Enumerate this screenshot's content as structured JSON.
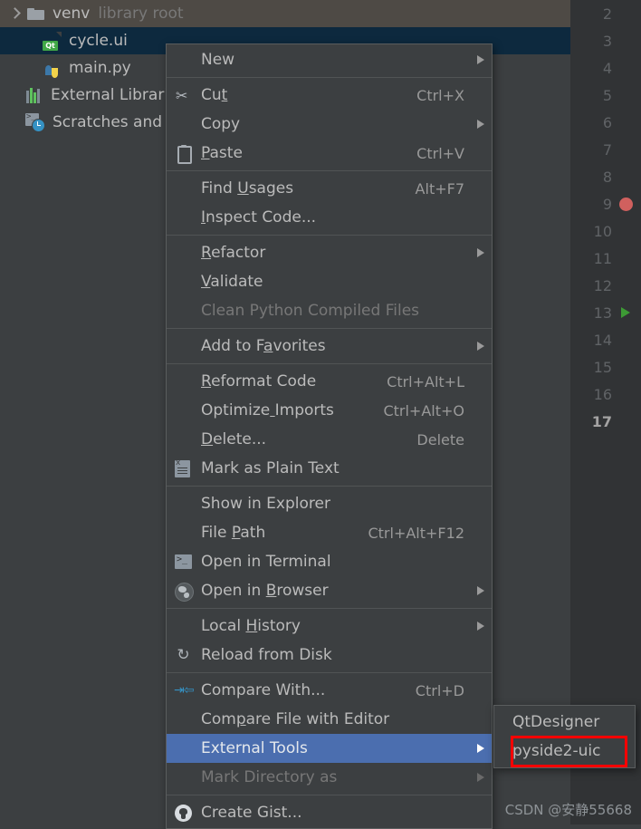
{
  "tree": {
    "rows": [
      {
        "label": "venv",
        "sub": "library root",
        "icon": "folder-icon",
        "state": "hovered",
        "indent": 0,
        "expander": "chevron-right-icon"
      },
      {
        "label": "cycle.ui",
        "sub": "",
        "icon": "qt-ui-file-icon",
        "state": "selected",
        "indent": 1,
        "expander": ""
      },
      {
        "label": "main.py",
        "sub": "",
        "icon": "python-file-icon",
        "state": "normal",
        "indent": 1,
        "expander": ""
      },
      {
        "label": "External Libraries",
        "sub": "",
        "icon": "libraries-bars-icon",
        "state": "normal",
        "indent": 0,
        "expander": ""
      },
      {
        "label": "Scratches and Co",
        "sub": "",
        "icon": "scratches-clock-icon",
        "state": "normal",
        "indent": 0,
        "expander": ""
      }
    ]
  },
  "gutter": {
    "lines": [
      {
        "num": "2",
        "marker": "",
        "current": false
      },
      {
        "num": "3",
        "marker": "",
        "current": false
      },
      {
        "num": "4",
        "marker": "",
        "current": false
      },
      {
        "num": "5",
        "marker": "",
        "current": false
      },
      {
        "num": "6",
        "marker": "",
        "current": false
      },
      {
        "num": "7",
        "marker": "",
        "current": false
      },
      {
        "num": "8",
        "marker": "",
        "current": false
      },
      {
        "num": "9",
        "marker": "breakpoint",
        "current": false
      },
      {
        "num": "10",
        "marker": "",
        "current": false
      },
      {
        "num": "11",
        "marker": "",
        "current": false
      },
      {
        "num": "12",
        "marker": "",
        "current": false
      },
      {
        "num": "13",
        "marker": "run",
        "current": false
      },
      {
        "num": "14",
        "marker": "",
        "current": false
      },
      {
        "num": "15",
        "marker": "",
        "current": false
      },
      {
        "num": "16",
        "marker": "",
        "current": false
      },
      {
        "num": "17",
        "marker": "",
        "current": true
      }
    ]
  },
  "context_menu": {
    "items": [
      {
        "label": "New",
        "shortcut": "",
        "icon": "",
        "submenu": true,
        "disabled": false,
        "selected": false,
        "sep_after": true
      },
      {
        "label": "Cut",
        "shortcut": "Ctrl+X",
        "icon": "scissors-icon",
        "submenu": false,
        "disabled": false,
        "selected": false,
        "sep_after": false
      },
      {
        "label": "Copy",
        "shortcut": "",
        "icon": "",
        "submenu": true,
        "disabled": false,
        "selected": false,
        "sep_after": false
      },
      {
        "label": "Paste",
        "shortcut": "Ctrl+V",
        "icon": "clipboard-icon",
        "submenu": false,
        "disabled": false,
        "selected": false,
        "sep_after": true
      },
      {
        "label": "Find Usages",
        "shortcut": "Alt+F7",
        "icon": "",
        "submenu": false,
        "disabled": false,
        "selected": false,
        "sep_after": false
      },
      {
        "label": "Inspect Code...",
        "shortcut": "",
        "icon": "",
        "submenu": false,
        "disabled": false,
        "selected": false,
        "sep_after": true
      },
      {
        "label": "Refactor",
        "shortcut": "",
        "icon": "",
        "submenu": true,
        "disabled": false,
        "selected": false,
        "sep_after": false
      },
      {
        "label": "Validate",
        "shortcut": "",
        "icon": "",
        "submenu": false,
        "disabled": false,
        "selected": false,
        "sep_after": false
      },
      {
        "label": "Clean Python Compiled Files",
        "shortcut": "",
        "icon": "",
        "submenu": false,
        "disabled": true,
        "selected": false,
        "sep_after": true
      },
      {
        "label": "Add to Favorites",
        "shortcut": "",
        "icon": "",
        "submenu": true,
        "disabled": false,
        "selected": false,
        "sep_after": true
      },
      {
        "label": "Reformat Code",
        "shortcut": "Ctrl+Alt+L",
        "icon": "",
        "submenu": false,
        "disabled": false,
        "selected": false,
        "sep_after": false
      },
      {
        "label": "Optimize Imports",
        "shortcut": "Ctrl+Alt+O",
        "icon": "",
        "submenu": false,
        "disabled": false,
        "selected": false,
        "sep_after": false
      },
      {
        "label": "Delete...",
        "shortcut": "Delete",
        "icon": "",
        "submenu": false,
        "disabled": false,
        "selected": false,
        "sep_after": false
      },
      {
        "label": "Mark as Plain Text",
        "shortcut": "",
        "icon": "plain-text-icon",
        "submenu": false,
        "disabled": false,
        "selected": false,
        "sep_after": true
      },
      {
        "label": "Show in Explorer",
        "shortcut": "",
        "icon": "",
        "submenu": false,
        "disabled": false,
        "selected": false,
        "sep_after": false
      },
      {
        "label": "File Path",
        "shortcut": "Ctrl+Alt+F12",
        "icon": "",
        "submenu": false,
        "disabled": false,
        "selected": false,
        "sep_after": false
      },
      {
        "label": "Open in Terminal",
        "shortcut": "",
        "icon": "terminal-icon",
        "submenu": false,
        "disabled": false,
        "selected": false,
        "sep_after": false
      },
      {
        "label": "Open in Browser",
        "shortcut": "",
        "icon": "globe-icon",
        "submenu": true,
        "disabled": false,
        "selected": false,
        "sep_after": true
      },
      {
        "label": "Local History",
        "shortcut": "",
        "icon": "",
        "submenu": true,
        "disabled": false,
        "selected": false,
        "sep_after": false
      },
      {
        "label": "Reload from Disk",
        "shortcut": "",
        "icon": "reload-icon",
        "submenu": false,
        "disabled": false,
        "selected": false,
        "sep_after": true
      },
      {
        "label": "Compare With...",
        "shortcut": "Ctrl+D",
        "icon": "compare-icon",
        "submenu": false,
        "disabled": false,
        "selected": false,
        "sep_after": false
      },
      {
        "label": "Compare File with Editor",
        "shortcut": "",
        "icon": "",
        "submenu": false,
        "disabled": false,
        "selected": false,
        "sep_after": false
      },
      {
        "label": "External Tools",
        "shortcut": "",
        "icon": "",
        "submenu": true,
        "disabled": false,
        "selected": true,
        "sep_after": false
      },
      {
        "label": "Mark Directory as",
        "shortcut": "",
        "icon": "",
        "submenu": true,
        "disabled": true,
        "selected": false,
        "sep_after": true
      },
      {
        "label": "Create Gist...",
        "shortcut": "",
        "icon": "github-icon",
        "submenu": false,
        "disabled": false,
        "selected": false,
        "sep_after": false
      }
    ]
  },
  "submenu": {
    "parent": "External Tools",
    "items": [
      {
        "label": "QtDesigner",
        "highlighted": false
      },
      {
        "label": "pyside2-uic",
        "highlighted": true
      }
    ]
  },
  "watermark": {
    "text": "CSDN @安静55668"
  },
  "colors": {
    "background": "#3C3F41",
    "gutter_background": "#313335",
    "selection_blue": "#4B6EAF",
    "tree_selected": "#0D293E",
    "tree_hover": "#4E4A45",
    "text": "#BBBBBB",
    "disabled_text": "#777777",
    "breakpoint_red": "#D0605E",
    "run_green": "#3D9A35",
    "highlight_box_red": "#FF0000"
  }
}
